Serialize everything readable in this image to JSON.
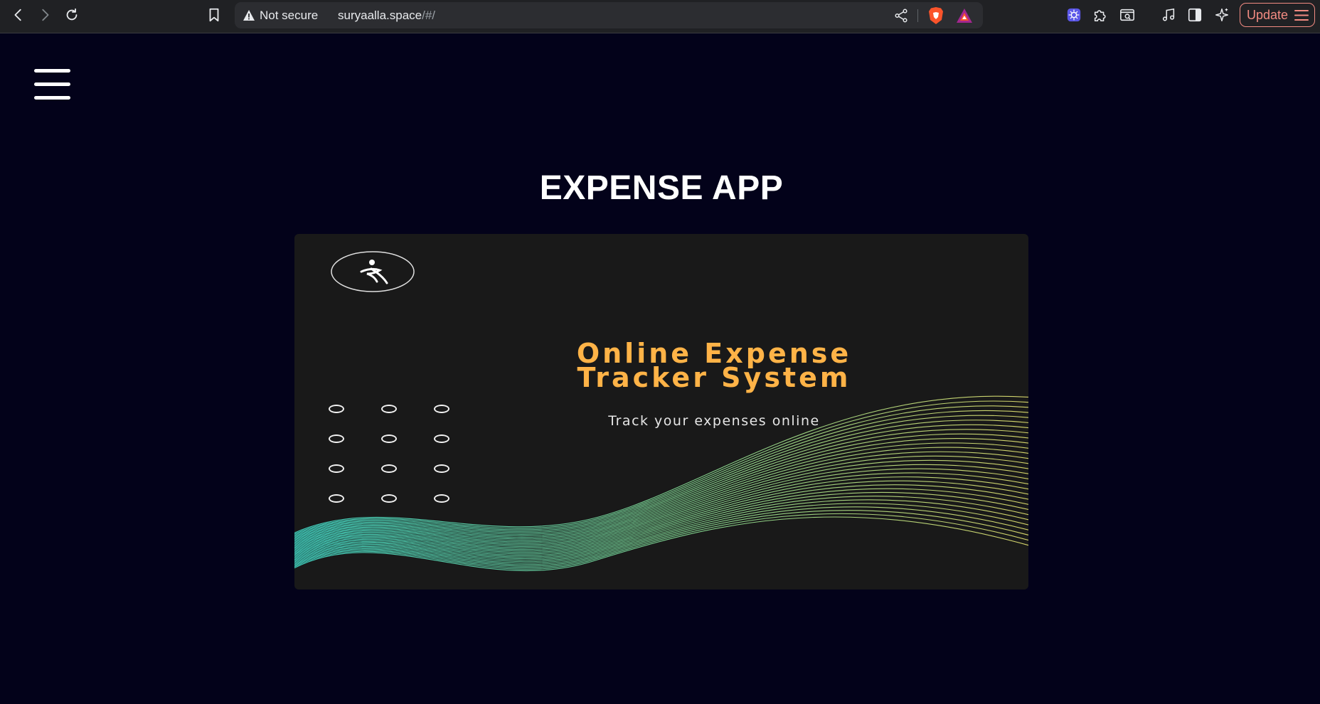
{
  "browser": {
    "security_label": "Not secure",
    "url_host": "suryaalla.space",
    "url_path": "/#/",
    "update_label": "Update"
  },
  "icons": {
    "back": "back-arrow-icon",
    "forward": "forward-arrow-icon",
    "reload": "reload-icon",
    "bookmark": "bookmark-icon",
    "share": "share-icon",
    "shields": "brave-shields-icon",
    "rewards": "brave-rewards-icon",
    "extensions": [
      "puzzle-icon",
      "screenshot-icon",
      "music-icon",
      "sidebar-icon",
      "sparkle-icon"
    ]
  },
  "colors": {
    "page_background": "#03021a",
    "banner_background": "#191919",
    "banner_title": "#ffb347",
    "update_accent": "#f28b82"
  },
  "page": {
    "title": "EXPENSE APP",
    "menu_icon": "hamburger-menu-icon"
  },
  "banner": {
    "title_line1": "Online Expense",
    "title_line2": "Tracker System",
    "subtitle": "Track your expenses online"
  }
}
